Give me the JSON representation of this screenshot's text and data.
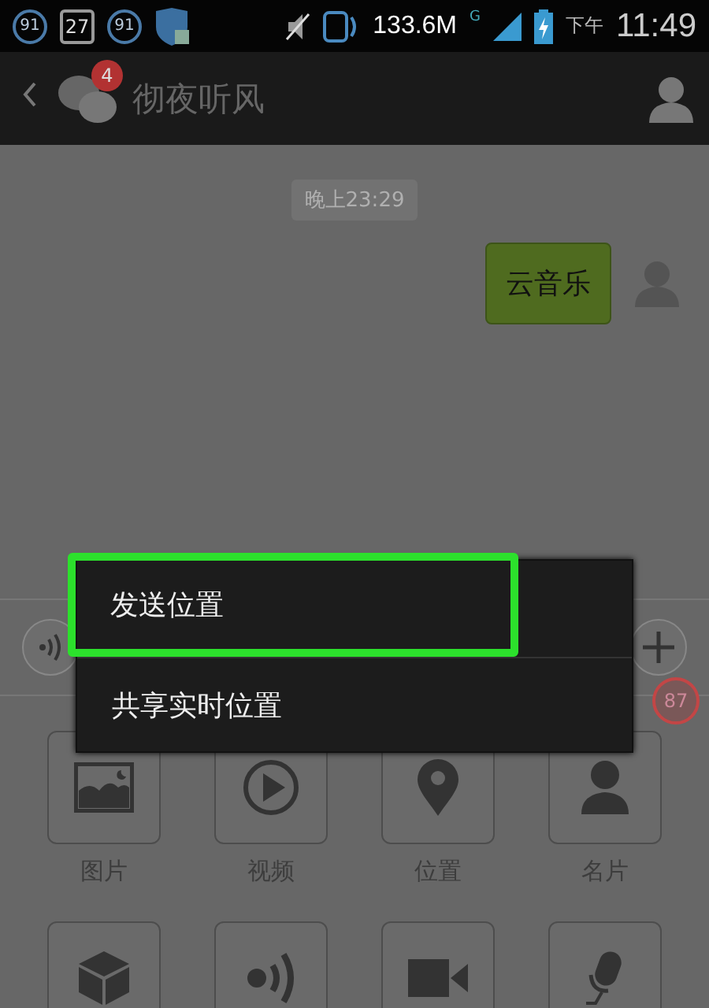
{
  "status_bar": {
    "notifications": [
      "91",
      "27",
      "91"
    ],
    "network_speed": "133.6M",
    "network_type": "G",
    "am_pm": "下午",
    "time": "11:49"
  },
  "header": {
    "badge": "4",
    "title": "彻夜听风"
  },
  "chat": {
    "timestamp": "晚上23:29",
    "messages": [
      {
        "text": "云音乐",
        "outgoing": true
      }
    ]
  },
  "menu": {
    "items": [
      {
        "label": "发送位置",
        "selected": true
      },
      {
        "label": "共享实时位置",
        "selected": false
      }
    ]
  },
  "floating_badge": "87",
  "attachments": [
    {
      "kind": "image",
      "label": "图片"
    },
    {
      "kind": "video",
      "label": "视频"
    },
    {
      "kind": "pin",
      "label": "位置"
    },
    {
      "kind": "person",
      "label": "名片"
    },
    {
      "kind": "cube"
    },
    {
      "kind": "radio"
    },
    {
      "kind": "camera"
    },
    {
      "kind": "mic"
    }
  ]
}
